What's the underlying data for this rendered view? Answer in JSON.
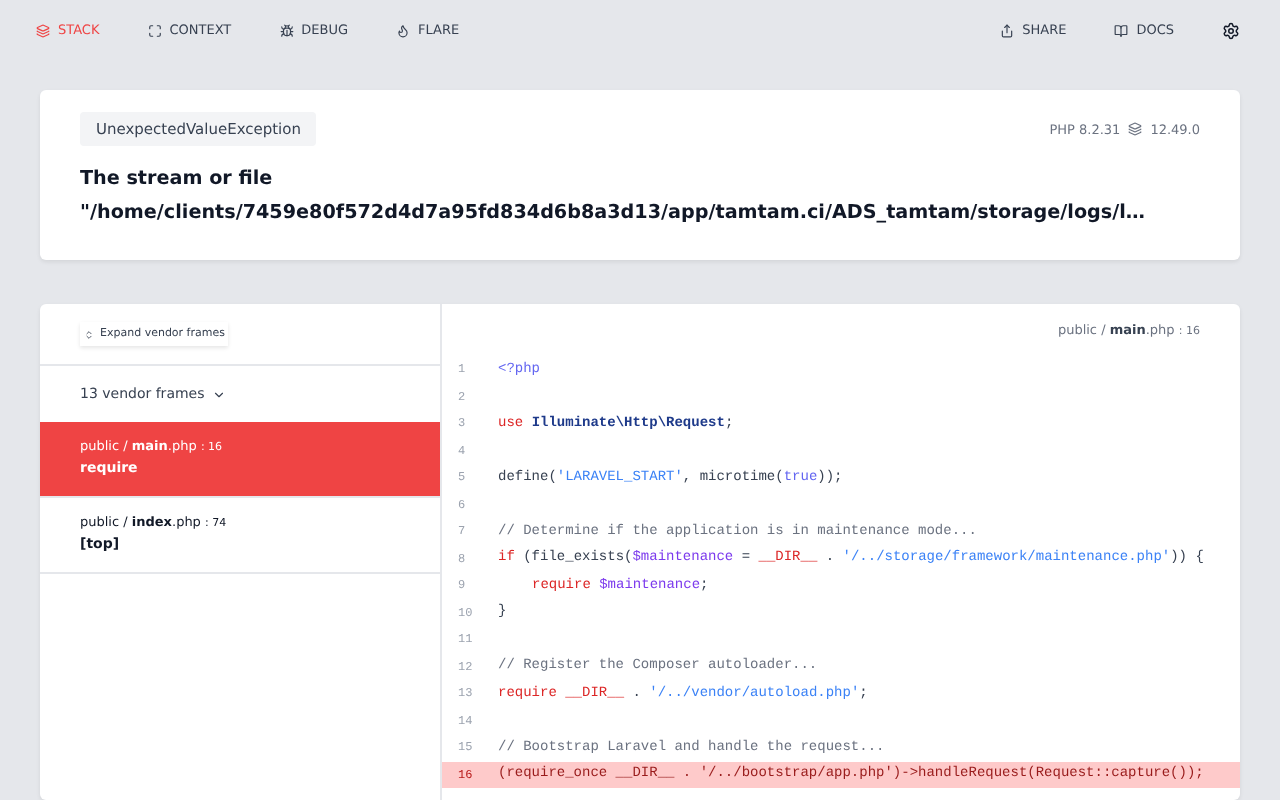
{
  "nav": {
    "left": [
      {
        "label": "STACK",
        "selected": true
      },
      {
        "label": "CONTEXT",
        "selected": false
      },
      {
        "label": "DEBUG",
        "selected": false
      },
      {
        "label": "FLARE",
        "selected": false
      }
    ],
    "right": [
      {
        "label": "SHARE"
      },
      {
        "label": "DOCS"
      }
    ]
  },
  "header": {
    "exception": "UnexpectedValueException",
    "php_version": "PHP 8.2.31",
    "laravel_version": "12.49.0",
    "message_line_1": "The stream or file",
    "message_line_2": "\"/home/clients/7459e80f572d4d7a95fd834d6b8a3d13/app/tamtam.ci/ADS_tamtam/storage/logs/l…"
  },
  "frames_panel": {
    "expand_button": "Expand vendor frames",
    "vendor_toggle": "13 vendor frames",
    "frames": [
      {
        "dir": "public / ",
        "file": "main",
        "ext": ".php",
        "line": ": 16",
        "call": "require",
        "selected": true
      },
      {
        "dir": "public / ",
        "file": "index",
        "ext": ".php",
        "line": ": 74",
        "call": "[top]",
        "selected": false
      }
    ]
  },
  "code": {
    "path_dir": "public / ",
    "path_file": "main",
    "path_ext": ".php",
    "path_line": ": 16",
    "lines": [
      {
        "no": "1",
        "highlighted": false,
        "segments": [
          {
            "kind": "tag",
            "text": "<?php"
          }
        ]
      },
      {
        "no": "2",
        "highlighted": false
      },
      {
        "no": "3",
        "highlighted": false,
        "segments": [
          {
            "kind": "keyword",
            "text": "use "
          },
          {
            "kind": "class",
            "text": "Illuminate\\Http\\Request"
          },
          {
            "kind": "plain",
            "text": ";"
          }
        ]
      },
      {
        "no": "4",
        "highlighted": false
      },
      {
        "no": "5",
        "highlighted": false,
        "segments": [
          {
            "kind": "plain",
            "text": "define("
          },
          {
            "kind": "string",
            "text": "'LARAVEL_START'"
          },
          {
            "kind": "plain",
            "text": ", microtime("
          },
          {
            "kind": "tag",
            "text": "true"
          },
          {
            "kind": "plain",
            "text": "));"
          }
        ]
      },
      {
        "no": "6",
        "highlighted": false
      },
      {
        "no": "7",
        "highlighted": false,
        "segments": [
          {
            "kind": "comment",
            "text": "// Determine if the application is in maintenance mode..."
          }
        ]
      },
      {
        "no": "8",
        "highlighted": false,
        "segments": [
          {
            "kind": "keyword",
            "text": "if "
          },
          {
            "kind": "plain",
            "text": "(file_exists("
          },
          {
            "kind": "variable",
            "text": "$maintenance"
          },
          {
            "kind": "plain",
            "text": " = "
          },
          {
            "kind": "keyword",
            "text": "__DIR__"
          },
          {
            "kind": "plain",
            "text": " . "
          },
          {
            "kind": "string",
            "text": "'/../storage/framework/maintenance.php'"
          },
          {
            "kind": "plain",
            "text": ")) {"
          }
        ]
      },
      {
        "no": "9",
        "highlighted": false,
        "indented": true,
        "segments": [
          {
            "kind": "keyword",
            "text": "require "
          },
          {
            "kind": "variable",
            "text": "$maintenance"
          },
          {
            "kind": "plain",
            "text": ";"
          }
        ]
      },
      {
        "no": "10",
        "highlighted": false,
        "segments": [
          {
            "kind": "plain",
            "text": "}"
          }
        ]
      },
      {
        "no": "11",
        "highlighted": false
      },
      {
        "no": "12",
        "highlighted": false,
        "segments": [
          {
            "kind": "comment",
            "text": "// Register the Composer autoloader..."
          }
        ]
      },
      {
        "no": "13",
        "highlighted": false,
        "segments": [
          {
            "kind": "keyword",
            "text": "require "
          },
          {
            "kind": "keyword",
            "text": "__DIR__"
          },
          {
            "kind": "plain",
            "text": " . "
          },
          {
            "kind": "string",
            "text": "'/../vendor/autoload.php'"
          },
          {
            "kind": "plain",
            "text": ";"
          }
        ]
      },
      {
        "no": "14",
        "highlighted": false
      },
      {
        "no": "15",
        "highlighted": false,
        "segments": [
          {
            "kind": "comment",
            "text": "// Bootstrap Laravel and handle the request..."
          }
        ]
      },
      {
        "no": "16",
        "highlighted": true,
        "segments": [
          {
            "kind": "plain",
            "text": "(require_once __DIR__ . '/../bootstrap/app.php')->handleRequest(Request::capture());"
          }
        ]
      }
    ]
  }
}
